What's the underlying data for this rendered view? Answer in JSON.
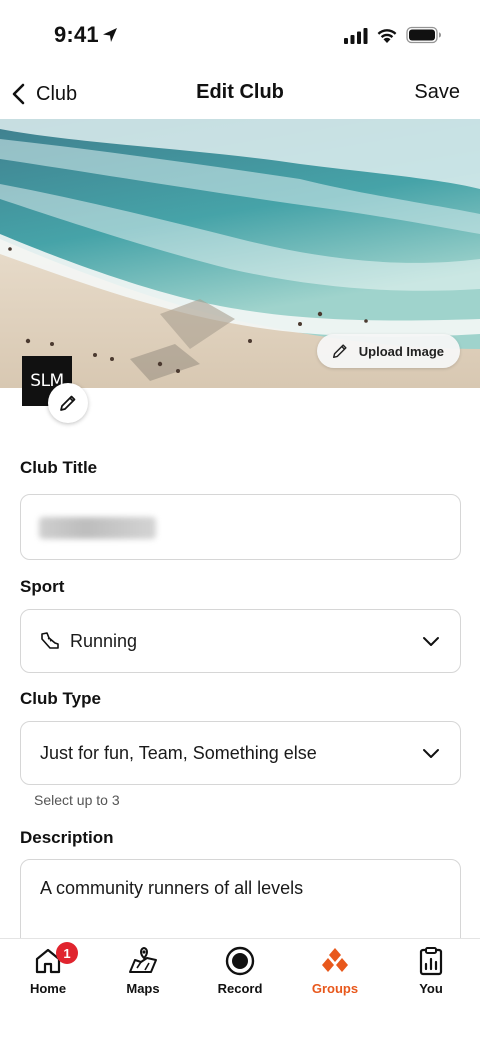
{
  "status_bar": {
    "time": "9:41"
  },
  "nav": {
    "back_label": "Club",
    "title": "Edit Club",
    "save_label": "Save"
  },
  "cover": {
    "upload_label": "Upload Image"
  },
  "club_logo": {
    "text": "SLM"
  },
  "form": {
    "title_label": "Club Title",
    "title_value": "",
    "sport_label": "Sport",
    "sport_value": "Running",
    "type_label": "Club Type",
    "type_value": "Just for fun, Team, Something else",
    "type_helper": "Select up to 3",
    "description_label": "Description",
    "description_value": "A community runners of all levels"
  },
  "tabs": [
    {
      "label": "Home",
      "icon": "home-icon",
      "badge": "1"
    },
    {
      "label": "Maps",
      "icon": "maps-icon"
    },
    {
      "label": "Record",
      "icon": "record-icon"
    },
    {
      "label": "Groups",
      "icon": "groups-icon",
      "active": true
    },
    {
      "label": "You",
      "icon": "you-icon"
    }
  ],
  "colors": {
    "accent": "#e8581c",
    "badge": "#e0242e",
    "border": "#d6d6d6"
  }
}
